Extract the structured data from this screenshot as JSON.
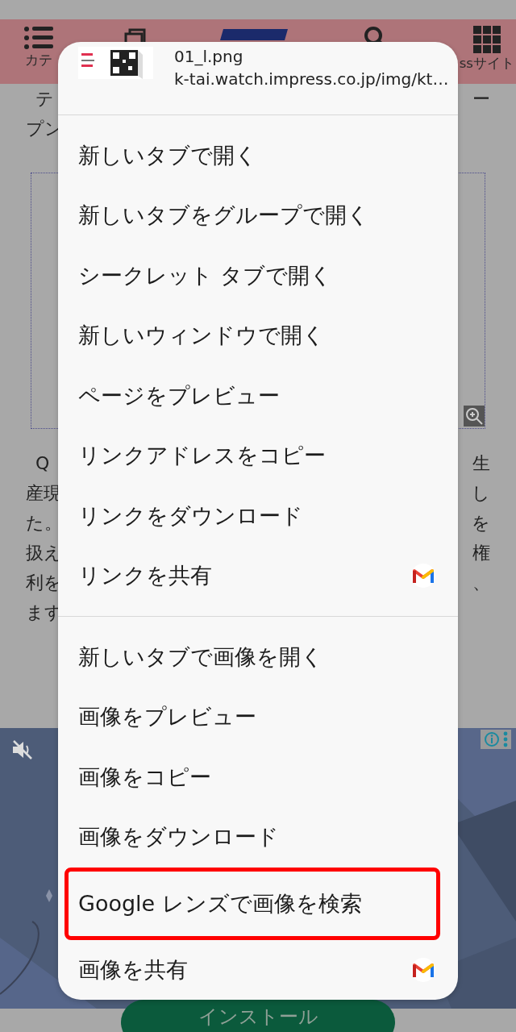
{
  "page": {
    "nav": [
      {
        "kind": "menu",
        "label": "カテ"
      },
      {
        "kind": "tabs"
      },
      {
        "kind": "logo"
      },
      {
        "kind": "search"
      },
      {
        "kind": "grid",
        "label": "ssサイト"
      }
    ],
    "article_top": [
      {
        "left": "テ",
        "right": "ー"
      },
      {
        "left": "プン"
      }
    ],
    "paragraph": [
      {
        "left": "Q",
        "right": "生"
      },
      {
        "left": "産現",
        "right": "し"
      },
      {
        "left": "た。",
        "right": "を"
      },
      {
        "left": "扱え",
        "right": "権"
      },
      {
        "left": "利を",
        "right": "、"
      },
      {
        "left": "ます"
      }
    ],
    "ad": {
      "kind": "picture",
      "install_button": "インストール"
    }
  },
  "context_menu": {
    "header": {
      "title": "01_l.png",
      "url": "k-tai.watch.impress.co.jp/img/kt…"
    },
    "groups": [
      [
        {
          "label": "新しいタブで開く",
          "kind": "plain",
          "highlighted": false
        },
        {
          "label": "新しいタブをグループで開く",
          "kind": "plain",
          "highlighted": false
        },
        {
          "label": "シークレット タブで開く",
          "kind": "plain",
          "highlighted": false
        },
        {
          "label": "新しいウィンドウで開く",
          "kind": "plain",
          "highlighted": false
        },
        {
          "label": "ページをプレビュー",
          "kind": "plain",
          "highlighted": false
        },
        {
          "label": "リンクアドレスをコピー",
          "kind": "plain",
          "highlighted": false
        },
        {
          "label": "リンクをダウンロード",
          "kind": "plain",
          "highlighted": false
        },
        {
          "label": "リンクを共有",
          "kind": "share",
          "highlighted": false
        }
      ],
      [
        {
          "label": "新しいタブで画像を開く",
          "kind": "plain",
          "highlighted": false
        },
        {
          "label": "画像をプレビュー",
          "kind": "plain",
          "highlighted": false
        },
        {
          "label": "画像をコピー",
          "kind": "plain",
          "highlighted": false
        },
        {
          "label": "画像をダウンロード",
          "kind": "plain",
          "highlighted": false
        },
        {
          "label": "Google レンズで画像を検索",
          "kind": "plain",
          "highlighted": true
        },
        {
          "label": "画像を共有",
          "kind": "share",
          "highlighted": false
        }
      ]
    ]
  }
}
